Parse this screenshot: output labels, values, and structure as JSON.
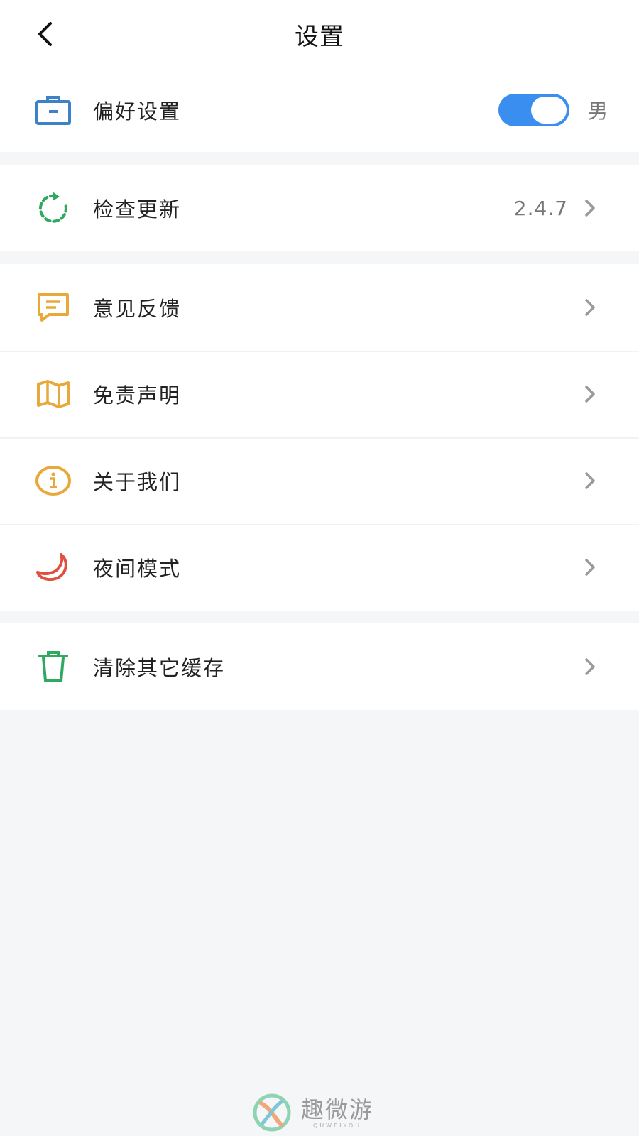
{
  "header": {
    "title": "设置",
    "back_icon": "chevron-left-icon"
  },
  "groups": [
    {
      "items": [
        {
          "label": "偏好设置",
          "icon": "briefcase-icon",
          "icon_color": "#3b82c8",
          "toggle_on": true,
          "value": "男"
        }
      ]
    },
    {
      "items": [
        {
          "label": "检查更新",
          "icon": "refresh-icon",
          "icon_color": "#2fa860",
          "value": "2.4.7"
        }
      ]
    },
    {
      "items": [
        {
          "label": "意见反馈",
          "icon": "message-icon",
          "icon_color": "#e8a93a"
        },
        {
          "label": "免责声明",
          "icon": "map-icon",
          "icon_color": "#e8a93a"
        },
        {
          "label": "关于我们",
          "icon": "info-icon",
          "icon_color": "#e8a93a"
        },
        {
          "label": "夜间模式",
          "icon": "moon-icon",
          "icon_color": "#e0503f"
        }
      ]
    },
    {
      "items": [
        {
          "label": "清除其它缓存",
          "icon": "trash-icon",
          "icon_color": "#2fa860"
        }
      ]
    }
  ],
  "colors": {
    "toggle_accent": "#3a8ef0",
    "background": "#f5f6f8",
    "chevron": "#9a9a9a"
  },
  "watermark": {
    "cn": "趣微游",
    "en": "QUWEIYOU"
  }
}
